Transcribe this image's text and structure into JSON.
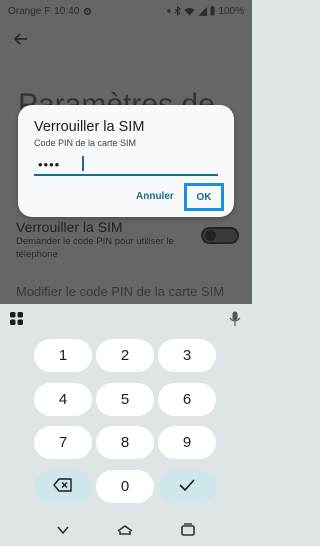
{
  "status_bar": {
    "carrier": "Orange F",
    "time": "10:40",
    "battery": "100%"
  },
  "background": {
    "title": "Paramètres de",
    "row_title": "Verrouiller la SIM",
    "row_subtitle": "Demander le code PIN pour utiliser le téléphone",
    "row2_title": "Modifier le code PIN de la carte SIM",
    "toggle_on": false
  },
  "dialog": {
    "title": "Verrouiller la SIM",
    "subtitle": "Code PIN de la carte SIM",
    "pin_value": "••••",
    "cancel_label": "Annuler",
    "ok_label": "OK"
  },
  "keyboard": {
    "keys": [
      "1",
      "2",
      "3",
      "4",
      "5",
      "6",
      "7",
      "8",
      "9",
      "0"
    ]
  },
  "colors": {
    "accent": "#1a6e8a",
    "highlight": "#1a8fe0",
    "key_alt": "#cfe6ea"
  }
}
